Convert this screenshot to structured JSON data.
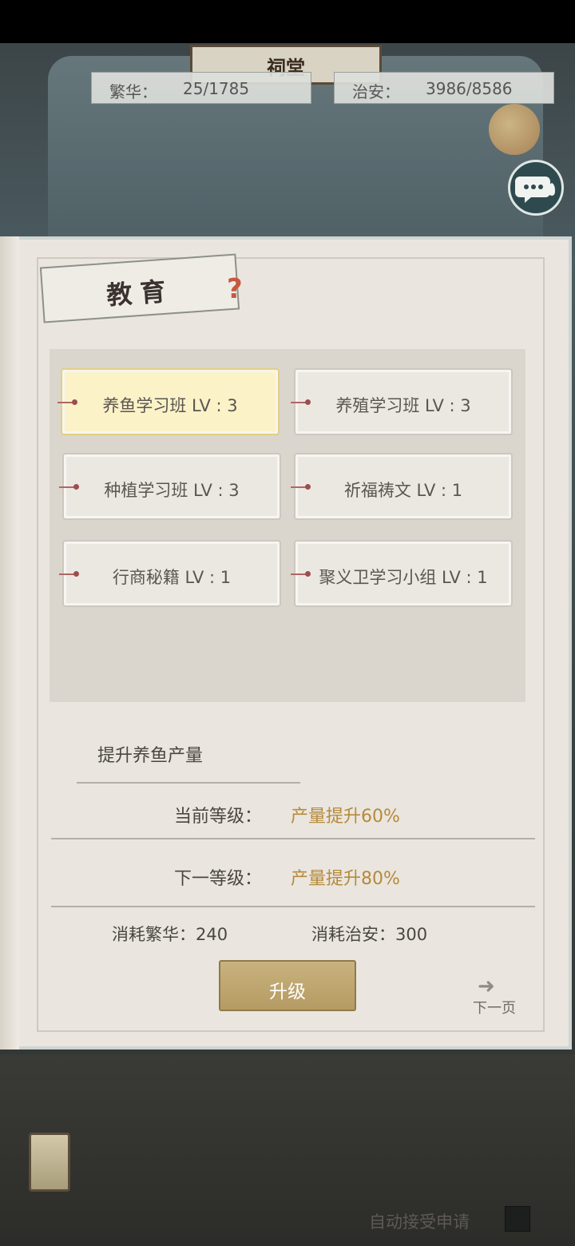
{
  "top_stats": {
    "prosperity_label": "繁华：",
    "prosperity_value": "25/1785",
    "security_label": "治安：",
    "security_value": "3986/8586"
  },
  "shrine_sign": "祠堂",
  "panel": {
    "title": "教育",
    "courses": [
      {
        "label": "养鱼学习班 LV : 3",
        "selected": true
      },
      {
        "label": "养殖学习班 LV : 3",
        "selected": false
      },
      {
        "label": "种植学习班 LV : 3",
        "selected": false
      },
      {
        "label": "祈福祷文 LV : 1",
        "selected": false
      },
      {
        "label": "行商秘籍 LV : 1",
        "selected": false
      },
      {
        "label": "聚义卫学习小组 LV : 1",
        "selected": false
      }
    ],
    "description": "提升养鱼产量",
    "current_level_label": "当前等级：",
    "current_level_value": "产量提升60%",
    "next_level_label": "下一等级：",
    "next_level_value": "产量提升80%",
    "cost_prosperity": "消耗繁华：240",
    "cost_security": "消耗治安：300",
    "upgrade_label": "升级",
    "next_page_label": "下一页"
  },
  "auto_accept_label": "自动接受申请",
  "colors": {
    "accent_gold": "#b58a3b",
    "selected_bg": "#fbf2c8",
    "button_gold": "#c2aa74"
  },
  "icons": {
    "help": "question-icon",
    "chat": "chat-bubble-icon",
    "next": "arrow-right-icon"
  }
}
